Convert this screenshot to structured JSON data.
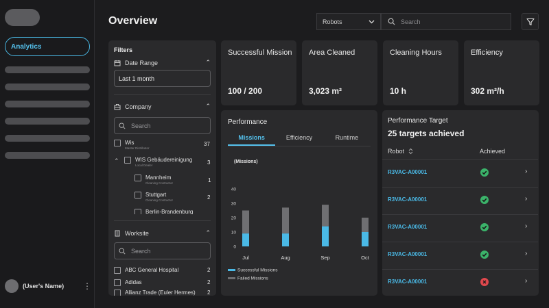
{
  "sidebar": {
    "active_item": "Analytics",
    "user_name": "(User's Name)",
    "more_icon": "⋮"
  },
  "header": {
    "title": "Overview",
    "robots_select": "Robots",
    "search_placeholder": "Search"
  },
  "filters": {
    "title": "Filters",
    "date_range": {
      "label": "Date Range",
      "value": "Last 1 month"
    },
    "company": {
      "label": "Company",
      "search_placeholder": "Search",
      "items": [
        {
          "name": "Wis",
          "subtitle": "Master Distributor",
          "count": "37"
        },
        {
          "name": "WIS Gebäudereinigung",
          "subtitle": "Local Dealer",
          "count": "3"
        },
        {
          "name": "Mannheim",
          "subtitle": "Cleaning Contractor",
          "count": "1"
        },
        {
          "name": "Stuttgart",
          "subtitle": "Cleaning Contractor",
          "count": "2"
        },
        {
          "name": "Berlin-Brandenburg",
          "subtitle": "",
          "count": ""
        }
      ]
    },
    "worksite": {
      "label": "Worksite",
      "search_placeholder": "Search",
      "items": [
        {
          "name": "ABC General Hospital",
          "count": "2"
        },
        {
          "name": "Adidas",
          "count": "2"
        },
        {
          "name": "Allianz Trade (Euler Hermes)",
          "count": "2"
        }
      ]
    }
  },
  "kpis": [
    {
      "title": "Successful Mission",
      "value": "100 / 200"
    },
    {
      "title": "Area Cleaned",
      "value": "3,023 m²"
    },
    {
      "title": "Cleaning Hours",
      "value": "10 h"
    },
    {
      "title": "Efficiency",
      "value": "302 m²/h"
    }
  ],
  "performance": {
    "title": "Performance",
    "tabs": [
      "Missions",
      "Efficiency",
      "Runtime"
    ],
    "active_tab": "Missions",
    "unit_label": "(Missions)"
  },
  "chart_data": {
    "type": "bar",
    "stacked": true,
    "categories": [
      "Jul",
      "Aug",
      "Sep",
      "Oct"
    ],
    "series": [
      {
        "name": "Successful Missions",
        "color": "#4ab9e6",
        "values": [
          9,
          9,
          14,
          10
        ]
      },
      {
        "name": "Failed Missions",
        "color": "#6f6f72",
        "values": [
          16,
          18,
          15,
          10
        ]
      }
    ],
    "ylim": [
      0,
      40
    ],
    "yticks": [
      0,
      10,
      20,
      30,
      40
    ],
    "title": "",
    "xlabel": "",
    "ylabel": "(Missions)",
    "legend_position": "bottom-left",
    "grid": false
  },
  "targets": {
    "title": "Performance Target",
    "summary": "25 targets achieved",
    "col_robot": "Robot",
    "col_achieved": "Achieved",
    "rows": [
      {
        "robot": "R3VAC-A00001",
        "achieved": true
      },
      {
        "robot": "R3VAC-A00001",
        "achieved": true
      },
      {
        "robot": "R3VAC-A00001",
        "achieved": true
      },
      {
        "robot": "R3VAC-A00001",
        "achieved": true
      },
      {
        "robot": "R3VAC-A00001",
        "achieved": false
      }
    ]
  },
  "colors": {
    "accent": "#4ab9e6",
    "success": "#3bb36a",
    "failure": "#e0484d"
  }
}
